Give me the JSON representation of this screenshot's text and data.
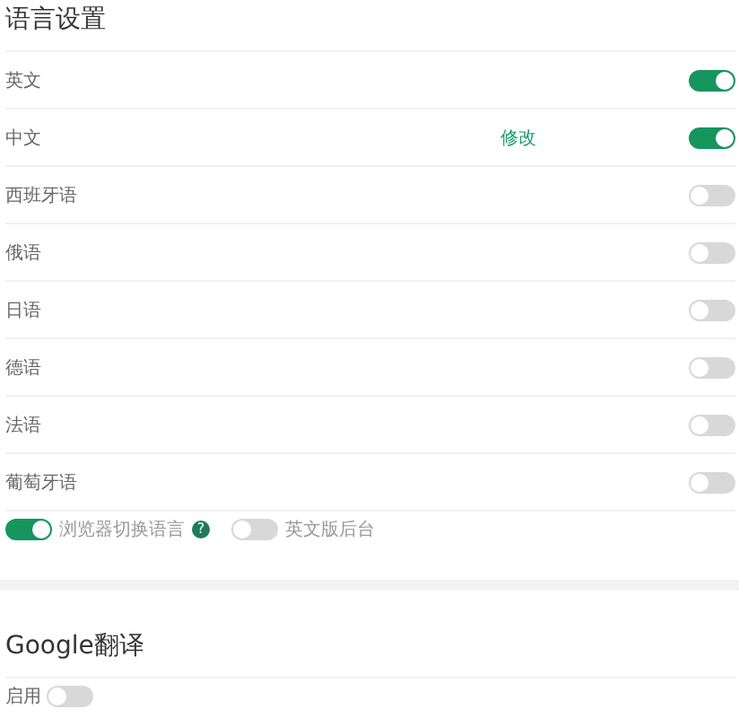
{
  "language_settings": {
    "title": "语言设置",
    "languages": [
      {
        "name": "英文",
        "on": true
      },
      {
        "name": "中文",
        "on": true,
        "action": "修改"
      },
      {
        "name": "西班牙语",
        "on": false
      },
      {
        "name": "俄语",
        "on": false
      },
      {
        "name": "日语",
        "on": false
      },
      {
        "name": "德语",
        "on": false
      },
      {
        "name": "法语",
        "on": false
      },
      {
        "name": "葡萄牙语",
        "on": false
      }
    ],
    "options": [
      {
        "label": "浏览器切换语言",
        "on": true,
        "help": "?"
      },
      {
        "label": "英文版后台",
        "on": false
      }
    ]
  },
  "google_translate": {
    "title": "Google翻译",
    "enable": {
      "label": "启用",
      "on": false
    }
  }
}
